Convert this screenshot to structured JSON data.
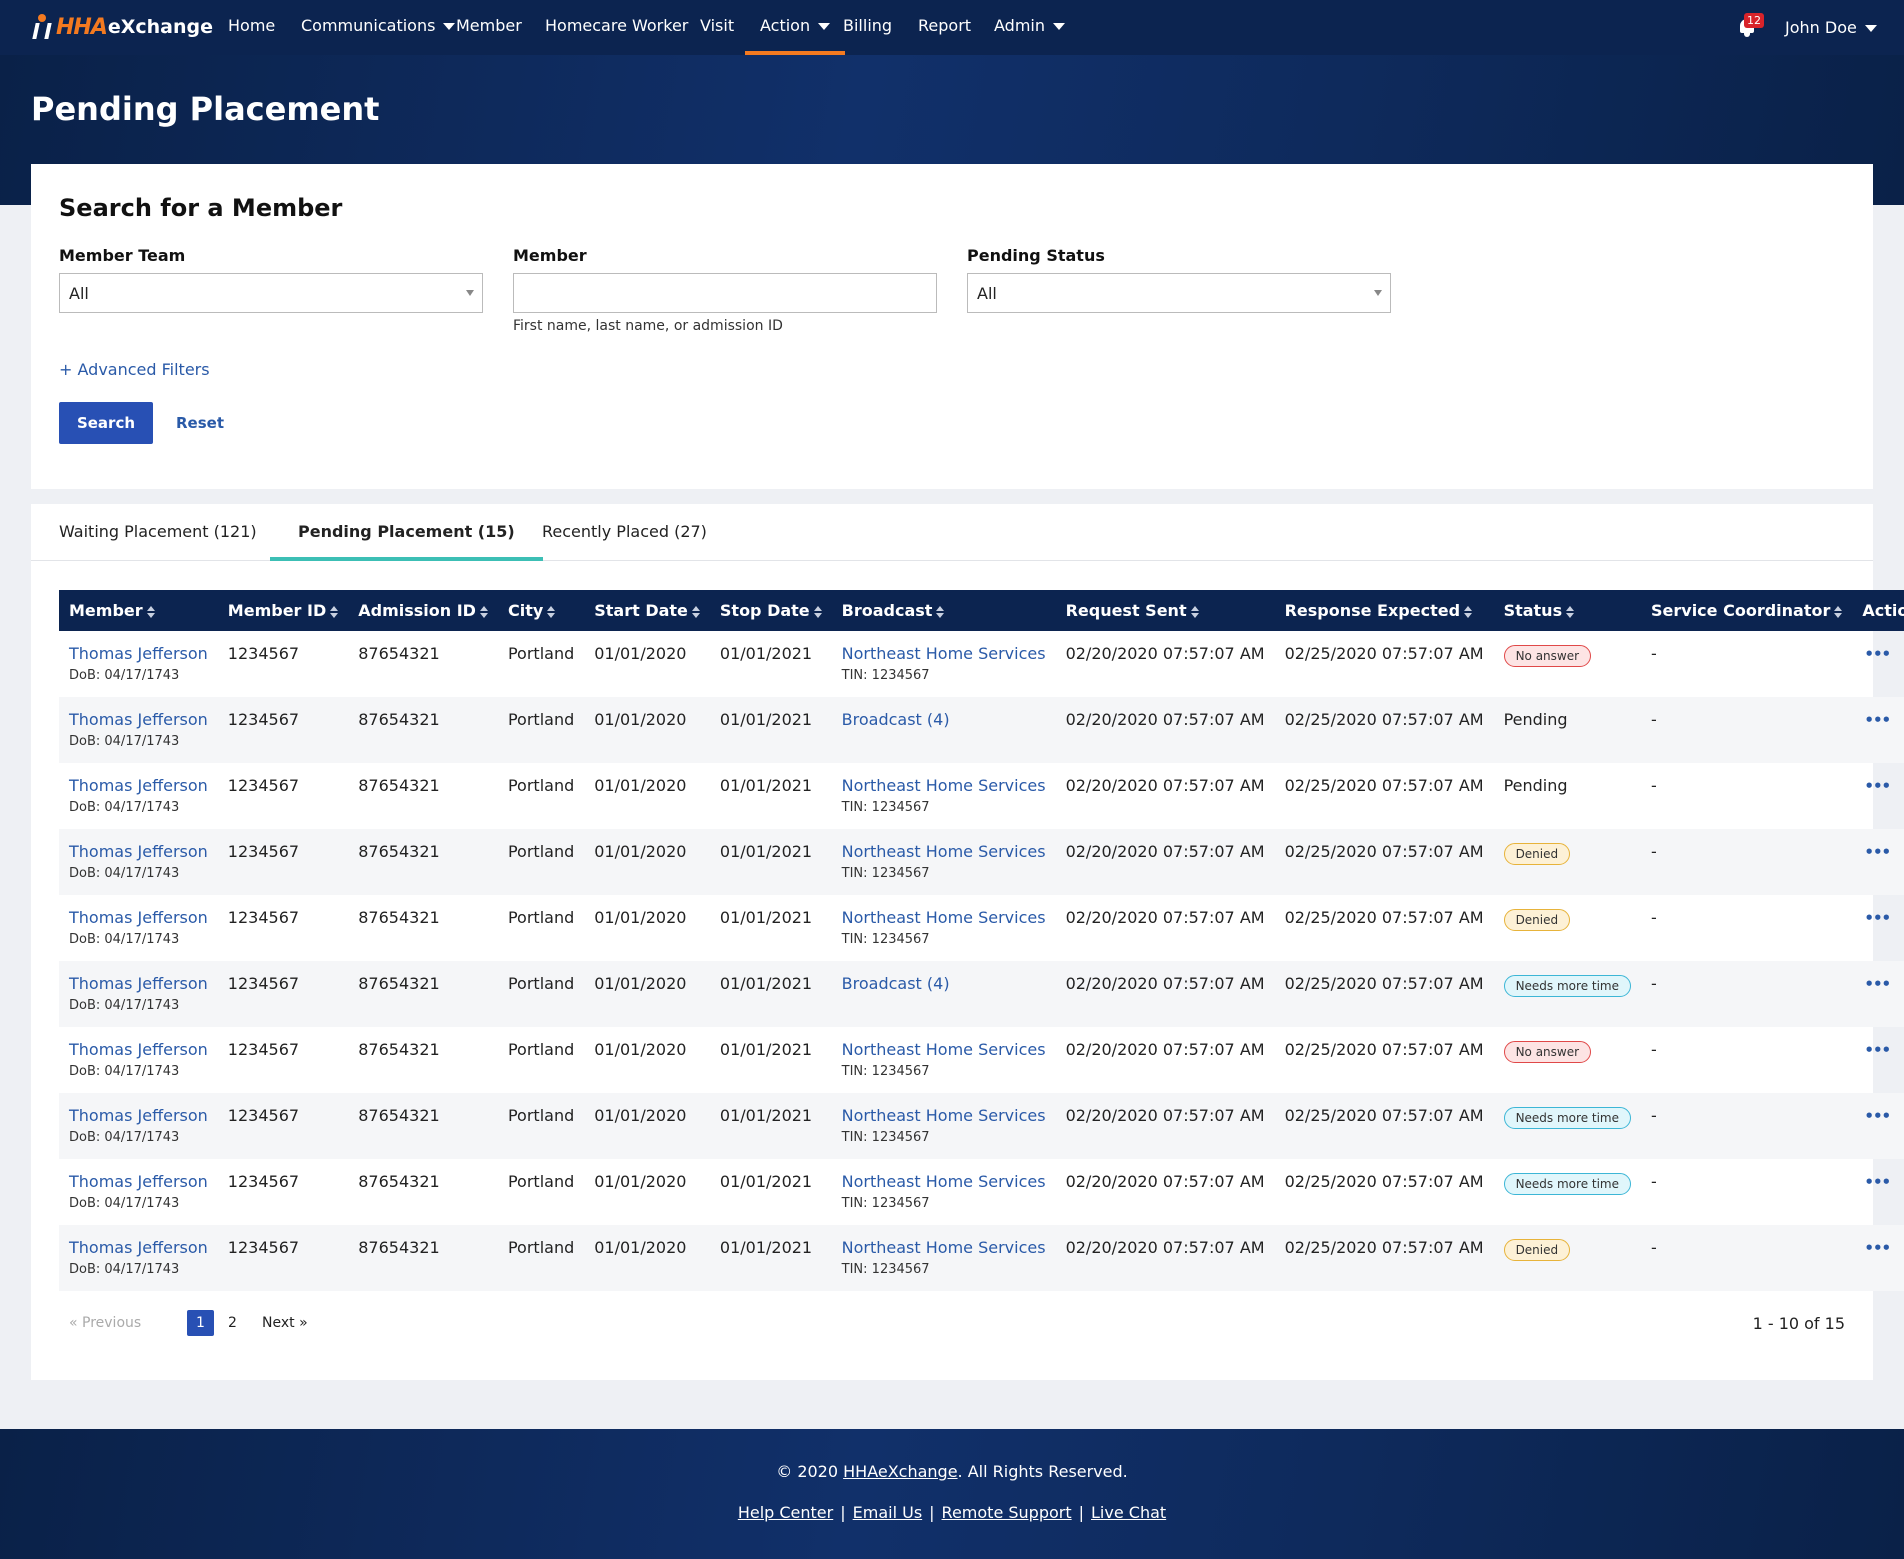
{
  "brand": {
    "logo_hha": "HHA",
    "logo_ex": "eXchange"
  },
  "nav": {
    "items": [
      {
        "label": "Home"
      },
      {
        "label": "Communications"
      },
      {
        "label": "Member"
      },
      {
        "label": "Homecare Worker"
      },
      {
        "label": "Visit"
      },
      {
        "label": "Action"
      },
      {
        "label": "Billing"
      },
      {
        "label": "Report"
      },
      {
        "label": "Admin"
      }
    ],
    "notifications": "12",
    "user": "John Doe"
  },
  "page": {
    "title": "Pending Placement"
  },
  "search": {
    "title": "Search for a Member",
    "member_team_label": "Member Team",
    "member_team_value": "All",
    "member_label": "Member",
    "member_value": "",
    "member_helper": "First name, last name, or admission ID",
    "pending_status_label": "Pending Status",
    "pending_status_value": "All",
    "advanced_filters": "+  Advanced Filters",
    "search_button": "Search",
    "reset_button": "Reset"
  },
  "tabs": [
    {
      "label": "Waiting Placement (121)"
    },
    {
      "label": "Pending Placement (15)"
    },
    {
      "label": "Recently Placed (27)"
    }
  ],
  "table": {
    "headers": [
      "Member",
      "Member ID",
      "Admission ID",
      "City",
      "Start Date",
      "Stop Date",
      "Broadcast",
      "Request Sent",
      "Response Expected",
      "Status",
      "Service Coordinator",
      "Actions"
    ],
    "rows": [
      {
        "member": "Thomas Jefferson",
        "dob": "DoB: 04/17/1743",
        "member_id": "1234567",
        "admission_id": "87654321",
        "city": "Portland",
        "start": "01/01/2020",
        "stop": "01/01/2021",
        "broadcast": "Northeast Home Services",
        "tin": "TIN: 1234567",
        "sent": "02/20/2020 07:57:07 AM",
        "expected": "02/25/2020 07:57:07 AM",
        "status": "No answer",
        "status_kind": "noanswer",
        "coordinator": "-",
        "actions": "•••"
      },
      {
        "member": "Thomas Jefferson",
        "dob": "DoB: 04/17/1743",
        "member_id": "1234567",
        "admission_id": "87654321",
        "city": "Portland",
        "start": "01/01/2020",
        "stop": "01/01/2021",
        "broadcast": "Broadcast (4)",
        "tin": "",
        "sent": "02/20/2020 07:57:07 AM",
        "expected": "02/25/2020 07:57:07 AM",
        "status": "Pending",
        "status_kind": "text",
        "coordinator": "-",
        "actions": "•••"
      },
      {
        "member": "Thomas Jefferson",
        "dob": "DoB: 04/17/1743",
        "member_id": "1234567",
        "admission_id": "87654321",
        "city": "Portland",
        "start": "01/01/2020",
        "stop": "01/01/2021",
        "broadcast": "Northeast Home Services",
        "tin": "TIN: 1234567",
        "sent": "02/20/2020 07:57:07 AM",
        "expected": "02/25/2020 07:57:07 AM",
        "status": "Pending",
        "status_kind": "text",
        "coordinator": "-",
        "actions": "•••"
      },
      {
        "member": "Thomas Jefferson",
        "dob": "DoB: 04/17/1743",
        "member_id": "1234567",
        "admission_id": "87654321",
        "city": "Portland",
        "start": "01/01/2020",
        "stop": "01/01/2021",
        "broadcast": "Northeast Home Services",
        "tin": "TIN: 1234567",
        "sent": "02/20/2020 07:57:07 AM",
        "expected": "02/25/2020 07:57:07 AM",
        "status": "Denied",
        "status_kind": "denied",
        "coordinator": "-",
        "actions": "•••"
      },
      {
        "member": "Thomas Jefferson",
        "dob": "DoB: 04/17/1743",
        "member_id": "1234567",
        "admission_id": "87654321",
        "city": "Portland",
        "start": "01/01/2020",
        "stop": "01/01/2021",
        "broadcast": "Northeast Home Services",
        "tin": "TIN: 1234567",
        "sent": "02/20/2020 07:57:07 AM",
        "expected": "02/25/2020 07:57:07 AM",
        "status": "Denied",
        "status_kind": "denied",
        "coordinator": "-",
        "actions": "•••"
      },
      {
        "member": "Thomas Jefferson",
        "dob": "DoB: 04/17/1743",
        "member_id": "1234567",
        "admission_id": "87654321",
        "city": "Portland",
        "start": "01/01/2020",
        "stop": "01/01/2021",
        "broadcast": "Broadcast (4)",
        "tin": "",
        "sent": "02/20/2020 07:57:07 AM",
        "expected": "02/25/2020 07:57:07 AM",
        "status": "Needs more time",
        "status_kind": "needs",
        "coordinator": "-",
        "actions": "•••"
      },
      {
        "member": "Thomas Jefferson",
        "dob": "DoB: 04/17/1743",
        "member_id": "1234567",
        "admission_id": "87654321",
        "city": "Portland",
        "start": "01/01/2020",
        "stop": "01/01/2021",
        "broadcast": "Northeast Home Services",
        "tin": "TIN: 1234567",
        "sent": "02/20/2020 07:57:07 AM",
        "expected": "02/25/2020 07:57:07 AM",
        "status": "No answer",
        "status_kind": "noanswer",
        "coordinator": "-",
        "actions": "•••"
      },
      {
        "member": "Thomas Jefferson",
        "dob": "DoB: 04/17/1743",
        "member_id": "1234567",
        "admission_id": "87654321",
        "city": "Portland",
        "start": "01/01/2020",
        "stop": "01/01/2021",
        "broadcast": "Northeast Home Services",
        "tin": "TIN: 1234567",
        "sent": "02/20/2020 07:57:07 AM",
        "expected": "02/25/2020 07:57:07 AM",
        "status": "Needs more time",
        "status_kind": "needs",
        "coordinator": "-",
        "actions": "•••"
      },
      {
        "member": "Thomas Jefferson",
        "dob": "DoB: 04/17/1743",
        "member_id": "1234567",
        "admission_id": "87654321",
        "city": "Portland",
        "start": "01/01/2020",
        "stop": "01/01/2021",
        "broadcast": "Northeast Home Services",
        "tin": "TIN: 1234567",
        "sent": "02/20/2020 07:57:07 AM",
        "expected": "02/25/2020 07:57:07 AM",
        "status": "Needs more time",
        "status_kind": "needs",
        "coordinator": "-",
        "actions": "•••"
      },
      {
        "member": "Thomas Jefferson",
        "dob": "DoB: 04/17/1743",
        "member_id": "1234567",
        "admission_id": "87654321",
        "city": "Portland",
        "start": "01/01/2020",
        "stop": "01/01/2021",
        "broadcast": "Northeast Home Services",
        "tin": "TIN: 1234567",
        "sent": "02/20/2020 07:57:07 AM",
        "expected": "02/25/2020 07:57:07 AM",
        "status": "Denied",
        "status_kind": "denied",
        "coordinator": "-",
        "actions": "•••"
      }
    ]
  },
  "pager": {
    "prev": "« Previous",
    "page1": "1",
    "page2": "2",
    "next": "Next »",
    "count": "1 - 10 of 15"
  },
  "footer": {
    "copy_pre": "© 2020 ",
    "copy_link": "HHAeXchange",
    "copy_post": ". All Rights Reserved.",
    "links": [
      "Help Center",
      "Email Us",
      "Remote Support",
      "Live Chat"
    ]
  },
  "colors": {
    "nav_bg": "#0c2450",
    "accent": "#f47a20",
    "primary": "#2850b4",
    "tab_active": "#3cbfb5"
  }
}
